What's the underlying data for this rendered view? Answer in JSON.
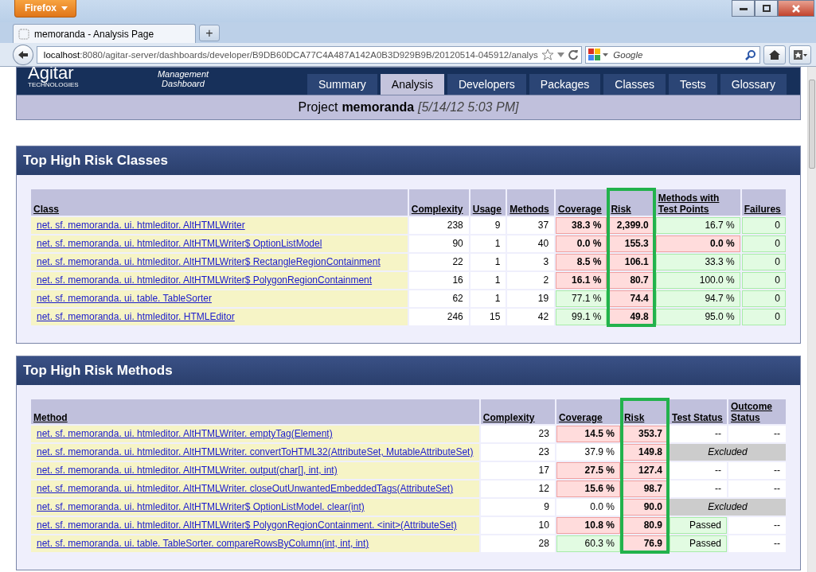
{
  "browser": {
    "app_button": "Firefox",
    "tab_title": "memoranda - Analysis Page",
    "new_tab": "+",
    "url_host": "localhost",
    "url_rest": ":8080/agitar-server/dashboards/developer/B9DB60DCA77C4A487A142A0B3D929B9B/20120514-045912/analys",
    "search": {
      "placeholder": "Google"
    }
  },
  "header": {
    "logo": "Agitar",
    "logo_sub": "TECHNOLOGIES",
    "product": "Management Dashboard",
    "tabs": [
      {
        "label": "Summary",
        "selected": false
      },
      {
        "label": "Analysis",
        "selected": true
      },
      {
        "label": "Developers",
        "selected": false
      },
      {
        "label": "Packages",
        "selected": false
      },
      {
        "label": "Classes",
        "selected": false
      },
      {
        "label": "Tests",
        "selected": false
      },
      {
        "label": "Glossary",
        "selected": false
      }
    ]
  },
  "project": {
    "label": "Project",
    "name": "memoranda",
    "date": "[5/14/12 5:03 PM]"
  },
  "sections": [
    {
      "title": "Top High Risk Classes",
      "columns": [
        {
          "label": "Class",
          "highlighted": false
        },
        {
          "label": "Complexity",
          "highlighted": false
        },
        {
          "label": "Usage",
          "highlighted": false
        },
        {
          "label": "Methods",
          "highlighted": false
        },
        {
          "label": "Coverage",
          "highlighted": false
        },
        {
          "label": "Risk",
          "highlighted": true
        },
        {
          "label": "Methods with Test Points",
          "highlighted": false
        },
        {
          "label": "Failures",
          "highlighted": false
        }
      ],
      "rows": [
        {
          "cells": [
            {
              "kind": "link",
              "text": "net. sf. memoranda. ui. htmleditor. AltHTMLWriter"
            },
            {
              "kind": "plain",
              "text": "238"
            },
            {
              "kind": "plain",
              "text": "9"
            },
            {
              "kind": "plain",
              "text": "37"
            },
            {
              "kind": "bad",
              "text": "38.3 %"
            },
            {
              "kind": "bad",
              "text": "2,399.0"
            },
            {
              "kind": "good",
              "text": "16.7 %"
            },
            {
              "kind": "good",
              "text": "0"
            }
          ]
        },
        {
          "cells": [
            {
              "kind": "link",
              "text": "net. sf. memoranda. ui. htmleditor. AltHTMLWriter$ OptionListModel"
            },
            {
              "kind": "plain",
              "text": "90"
            },
            {
              "kind": "plain",
              "text": "1"
            },
            {
              "kind": "plain",
              "text": "40"
            },
            {
              "kind": "bad",
              "text": "0.0 %"
            },
            {
              "kind": "bad",
              "text": "155.3"
            },
            {
              "kind": "bad",
              "text": "0.0 %"
            },
            {
              "kind": "good",
              "text": "0"
            }
          ]
        },
        {
          "cells": [
            {
              "kind": "link",
              "text": "net. sf. memoranda. ui. htmleditor. AltHTMLWriter$ RectangleRegionContainment"
            },
            {
              "kind": "plain",
              "text": "22"
            },
            {
              "kind": "plain",
              "text": "1"
            },
            {
              "kind": "plain",
              "text": "3"
            },
            {
              "kind": "bad",
              "text": "8.5 %"
            },
            {
              "kind": "bad",
              "text": "106.1"
            },
            {
              "kind": "good",
              "text": "33.3 %"
            },
            {
              "kind": "good",
              "text": "0"
            }
          ]
        },
        {
          "cells": [
            {
              "kind": "link",
              "text": "net. sf. memoranda. ui. htmleditor. AltHTMLWriter$ PolygonRegionContainment"
            },
            {
              "kind": "plain",
              "text": "16"
            },
            {
              "kind": "plain",
              "text": "1"
            },
            {
              "kind": "plain",
              "text": "2"
            },
            {
              "kind": "bad",
              "text": "16.1 %"
            },
            {
              "kind": "bad",
              "text": "80.7"
            },
            {
              "kind": "good",
              "text": "100.0 %"
            },
            {
              "kind": "good",
              "text": "0"
            }
          ]
        },
        {
          "cells": [
            {
              "kind": "link",
              "text": "net. sf. memoranda. ui. table. TableSorter"
            },
            {
              "kind": "plain",
              "text": "62"
            },
            {
              "kind": "plain",
              "text": "1"
            },
            {
              "kind": "plain",
              "text": "19"
            },
            {
              "kind": "good",
              "text": "77.1 %"
            },
            {
              "kind": "bad",
              "text": "74.4"
            },
            {
              "kind": "good",
              "text": "94.7 %"
            },
            {
              "kind": "good",
              "text": "0"
            }
          ]
        },
        {
          "cells": [
            {
              "kind": "link",
              "text": "net. sf. memoranda. ui. htmleditor. HTMLEditor"
            },
            {
              "kind": "plain",
              "text": "246"
            },
            {
              "kind": "plain",
              "text": "15"
            },
            {
              "kind": "plain",
              "text": "42"
            },
            {
              "kind": "good",
              "text": "99.1 %"
            },
            {
              "kind": "bad",
              "text": "49.8"
            },
            {
              "kind": "good",
              "text": "95.0 %"
            },
            {
              "kind": "good",
              "text": "0"
            }
          ]
        }
      ]
    },
    {
      "title": "Top High Risk Methods",
      "columns": [
        {
          "label": "Method",
          "highlighted": false
        },
        {
          "label": "Complexity",
          "highlighted": false
        },
        {
          "label": "Coverage",
          "highlighted": false
        },
        {
          "label": "Risk",
          "highlighted": true
        },
        {
          "label": "Test Status",
          "highlighted": false
        },
        {
          "label": "Outcome Status",
          "highlighted": false
        }
      ],
      "rows": [
        {
          "cells": [
            {
              "kind": "link",
              "text": "net. sf. memoranda. ui. htmleditor. AltHTMLWriter. emptyTag(Element)"
            },
            {
              "kind": "plain",
              "text": "23"
            },
            {
              "kind": "bad",
              "text": "14.5 %"
            },
            {
              "kind": "bad",
              "text": "353.7"
            },
            {
              "kind": "plain",
              "text": "--"
            },
            {
              "kind": "plain",
              "text": "--"
            }
          ]
        },
        {
          "cells": [
            {
              "kind": "link",
              "text": "net. sf. memoranda. ui. htmleditor. AltHTMLWriter. convertToHTML32(AttributeSet, MutableAttributeSet)"
            },
            {
              "kind": "plain",
              "text": "23"
            },
            {
              "kind": "plain",
              "text": "37.9 %"
            },
            {
              "kind": "bad",
              "text": "149.8"
            },
            {
              "kind": "excluded",
              "text": "Excluded",
              "colspan": 2
            }
          ]
        },
        {
          "cells": [
            {
              "kind": "link",
              "text": "net. sf. memoranda. ui. htmleditor. AltHTMLWriter. output(char[], int, int)"
            },
            {
              "kind": "plain",
              "text": "17"
            },
            {
              "kind": "bad",
              "text": "27.5 %"
            },
            {
              "kind": "bad",
              "text": "127.4"
            },
            {
              "kind": "plain",
              "text": "--"
            },
            {
              "kind": "plain",
              "text": "--"
            }
          ]
        },
        {
          "cells": [
            {
              "kind": "link",
              "text": "net. sf. memoranda. ui. htmleditor. AltHTMLWriter. closeOutUnwantedEmbeddedTags(AttributeSet)"
            },
            {
              "kind": "plain",
              "text": "12"
            },
            {
              "kind": "bad",
              "text": "15.6 %"
            },
            {
              "kind": "bad",
              "text": "98.7"
            },
            {
              "kind": "plain",
              "text": "--"
            },
            {
              "kind": "plain",
              "text": "--"
            }
          ]
        },
        {
          "cells": [
            {
              "kind": "link",
              "text": "net. sf. memoranda. ui. htmleditor. AltHTMLWriter$ OptionListModel. clear(int)"
            },
            {
              "kind": "plain",
              "text": "9"
            },
            {
              "kind": "plain",
              "text": "0.0 %"
            },
            {
              "kind": "bad",
              "text": "90.0"
            },
            {
              "kind": "excluded",
              "text": "Excluded",
              "colspan": 2
            }
          ]
        },
        {
          "cells": [
            {
              "kind": "link",
              "text": "net. sf. memoranda. ui. htmleditor. AltHTMLWriter$ PolygonRegionContainment. <init>(AttributeSet)"
            },
            {
              "kind": "plain",
              "text": "10"
            },
            {
              "kind": "bad",
              "text": "10.8 %"
            },
            {
              "kind": "bad",
              "text": "80.9"
            },
            {
              "kind": "good",
              "text": "Passed"
            },
            {
              "kind": "plain",
              "text": "--"
            }
          ]
        },
        {
          "cells": [
            {
              "kind": "link",
              "text": "net. sf. memoranda. ui. table. TableSorter. compareRowsByColumn(int, int, int)"
            },
            {
              "kind": "plain",
              "text": "28"
            },
            {
              "kind": "good",
              "text": "60.3 %"
            },
            {
              "kind": "bad",
              "text": "76.9"
            },
            {
              "kind": "good",
              "text": "Passed"
            },
            {
              "kind": "plain",
              "text": "--"
            }
          ]
        }
      ]
    }
  ]
}
